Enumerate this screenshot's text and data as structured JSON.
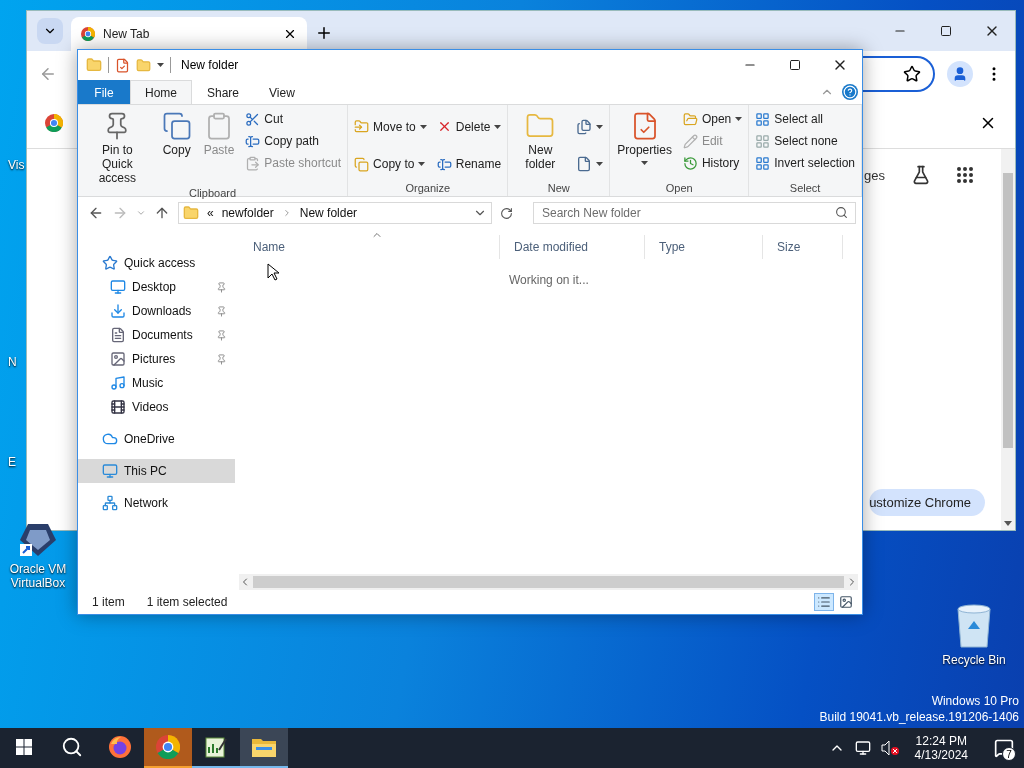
{
  "desktop": {
    "edge_labels": [
      "Vis",
      "N",
      "E"
    ],
    "shortcut": {
      "label": "Oracle VM VirtualBox"
    },
    "recycle_bin": {
      "label": "Recycle Bin"
    },
    "edition": [
      "Windows 10 Pro",
      "Build 19041.vb_release.191206-1406"
    ]
  },
  "browser": {
    "tab": {
      "title": "New Tab"
    },
    "page_link": "ges",
    "customize_button": "ustomize Chrome"
  },
  "explorer": {
    "title": "New folder",
    "ribbon_tabs": [
      {
        "label": "File",
        "kind": "file",
        "selected": false
      },
      {
        "label": "Home",
        "kind": "tab",
        "selected": true
      },
      {
        "label": "Share",
        "kind": "tab",
        "selected": false
      },
      {
        "label": "View",
        "kind": "tab",
        "selected": false
      }
    ],
    "ribbon_groups": [
      {
        "label": "Clipboard",
        "columns": [
          [
            {
              "kind": "large",
              "label": "Pin to Quick access",
              "disabled": false,
              "dropdown": false
            }
          ],
          [
            {
              "kind": "large",
              "label": "Copy",
              "disabled": false,
              "dropdown": false
            }
          ],
          [
            {
              "kind": "large",
              "label": "Paste",
              "disabled": true,
              "dropdown": false
            }
          ],
          [
            {
              "kind": "small",
              "label": "Cut",
              "disabled": false,
              "dropdown": false
            },
            {
              "kind": "small",
              "label": "Copy path",
              "disabled": false,
              "dropdown": false
            },
            {
              "kind": "small",
              "label": "Paste shortcut",
              "disabled": true,
              "dropdown": false
            }
          ]
        ]
      },
      {
        "label": "Organize",
        "columns": [
          [
            {
              "kind": "small",
              "label": "Move to",
              "disabled": false,
              "dropdown": true
            },
            {
              "kind": "small",
              "label": "Copy to",
              "disabled": false,
              "dropdown": true
            }
          ],
          [
            {
              "kind": "small",
              "label": "Delete",
              "disabled": false,
              "dropdown": true
            },
            {
              "kind": "small",
              "label": "Rename",
              "disabled": false,
              "dropdown": false
            }
          ]
        ]
      },
      {
        "label": "New",
        "columns": [
          [
            {
              "kind": "large",
              "label": "New folder",
              "disabled": false,
              "dropdown": false
            }
          ],
          [
            {
              "kind": "icon",
              "disabled": false,
              "dropdown": true
            },
            {
              "kind": "icon",
              "disabled": false,
              "dropdown": true
            }
          ]
        ]
      },
      {
        "label": "Open",
        "columns": [
          [
            {
              "kind": "large",
              "label": "Properties",
              "disabled": false,
              "dropdown": true
            }
          ],
          [
            {
              "kind": "small",
              "label": "Open",
              "disabled": false,
              "dropdown": true
            },
            {
              "kind": "small",
              "label": "Edit",
              "disabled": true,
              "dropdown": false
            },
            {
              "kind": "small",
              "label": "History",
              "disabled": false,
              "dropdown": false
            }
          ]
        ]
      },
      {
        "label": "Select",
        "columns": [
          [
            {
              "kind": "small",
              "label": "Select all",
              "disabled": false,
              "dropdown": false
            },
            {
              "kind": "small",
              "label": "Select none",
              "disabled": false,
              "dropdown": false
            },
            {
              "kind": "small",
              "label": "Invert selection",
              "disabled": false,
              "dropdown": false
            }
          ]
        ]
      }
    ],
    "address": {
      "overflow": "«",
      "crumbs": [
        "newfolder",
        "New folder"
      ]
    },
    "search": {
      "placeholder": "Search New folder"
    },
    "nav": [
      {
        "label": "Quick access",
        "selected": false,
        "children": [
          {
            "label": "Desktop",
            "pinned": true,
            "selected": false
          },
          {
            "label": "Downloads",
            "pinned": true,
            "selected": false
          },
          {
            "label": "Documents",
            "pinned": true,
            "selected": false
          },
          {
            "label": "Pictures",
            "pinned": true,
            "selected": false
          },
          {
            "label": "Music",
            "pinned": false,
            "selected": false
          },
          {
            "label": "Videos",
            "pinned": false,
            "selected": false
          }
        ]
      },
      {
        "label": "OneDrive",
        "selected": false
      },
      {
        "label": "This PC",
        "selected": true
      },
      {
        "label": "Network",
        "selected": false
      }
    ],
    "columns": [
      "Name",
      "Date modified",
      "Type",
      "Size"
    ],
    "message": "Working on it...",
    "status_bar": [
      "1 item",
      "1 item selected"
    ],
    "views": [
      {
        "kind": "details",
        "selected": true
      },
      {
        "kind": "thumbnails",
        "selected": false
      }
    ]
  },
  "taskbar": {
    "apps": [
      {
        "kind": "start",
        "running": false,
        "attention": false,
        "selected": false
      },
      {
        "kind": "search",
        "running": false,
        "attention": false,
        "selected": false
      },
      {
        "kind": "firefox",
        "running": false,
        "attention": false,
        "selected": false
      },
      {
        "kind": "chrome",
        "running": true,
        "attention": true,
        "selected": false
      },
      {
        "kind": "editor",
        "running": true,
        "attention": false,
        "selected": false
      },
      {
        "kind": "explorer",
        "running": true,
        "attention": false,
        "selected": true
      }
    ],
    "time": "12:24 PM",
    "date": "4/13/2024",
    "notification_count": "7"
  }
}
